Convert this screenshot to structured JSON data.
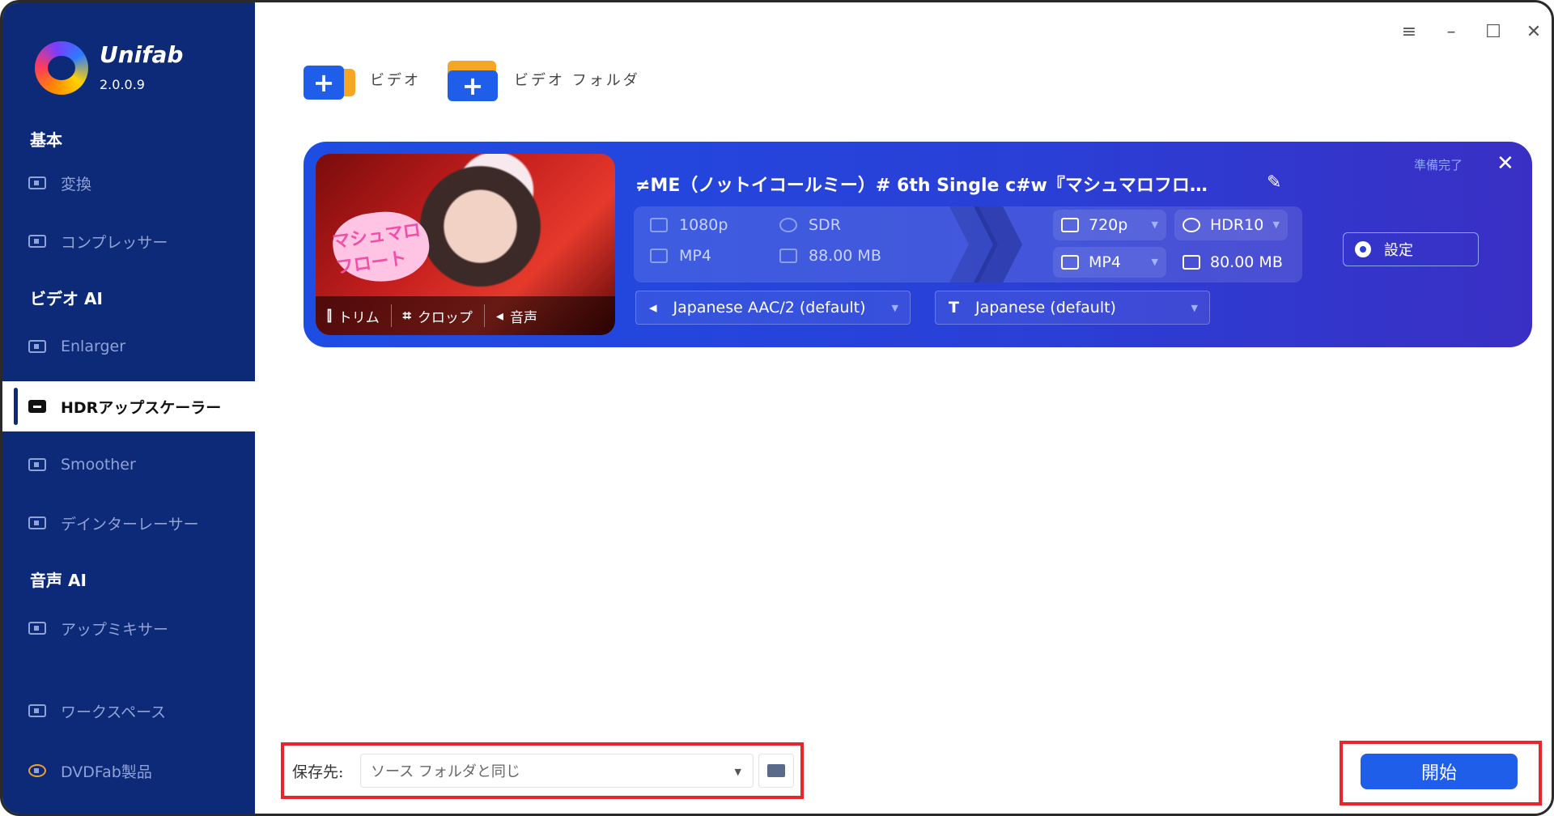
{
  "app": {
    "name": "Unifab",
    "version": "2.0.0.9"
  },
  "window_controls": {
    "menu": "≡",
    "minimize": "–",
    "maximize": "☐",
    "close": "✕"
  },
  "sidebar": {
    "sections": [
      {
        "title": "基本",
        "items": [
          {
            "label": "変換",
            "icon": "convert-icon"
          },
          {
            "label": "コンプレッサー",
            "icon": "compressor-icon"
          }
        ]
      },
      {
        "title": "ビデオ AI",
        "items": [
          {
            "label": "Enlarger",
            "icon": "enlarger-icon"
          },
          {
            "label": "HDRアップスケーラー",
            "icon": "hdr-icon",
            "active": true
          },
          {
            "label": "Smoother",
            "icon": "smoother-icon"
          },
          {
            "label": "デインターレーサー",
            "icon": "deinterlacer-icon"
          }
        ]
      },
      {
        "title": "音声 AI",
        "items": [
          {
            "label": "アップミキサー",
            "icon": "upmixer-icon"
          }
        ]
      }
    ],
    "bottom": [
      {
        "label": "ワークスペース",
        "icon": "workspace-icon"
      },
      {
        "label": "DVDFab製品",
        "icon": "dvdfab-icon"
      }
    ]
  },
  "toolbar": {
    "add_video": "ビデオ",
    "add_folder": "ビデオ フォルダ"
  },
  "task": {
    "title": "≠ME（ノットイコールミー）# 6th Single c#w『マシュマロフロ…",
    "status": "準備完了",
    "thumb_sticker": "マシュマロ フロート",
    "thumb_tools": {
      "trim": "トリム",
      "crop": "クロップ",
      "audio": "音声"
    },
    "source": {
      "resolution": "1080p",
      "dynamic_range": "SDR",
      "format": "MP4",
      "size": "88.00 MB"
    },
    "target": {
      "resolution": "720p",
      "dynamic_range": "HDR10",
      "format": "MP4",
      "size": "80.00 MB"
    },
    "settings_label": "設定",
    "audio_track": "Japanese AAC/2 (default)",
    "subtitle_track": "Japanese (default)"
  },
  "bottom_bar": {
    "save_label": "保存先:",
    "save_value": "ソース フォルダと同じ",
    "start": "開始"
  },
  "colors": {
    "sidebar": "#0d2a78",
    "accent": "#1f5ee8",
    "highlight": "#e8262a"
  }
}
